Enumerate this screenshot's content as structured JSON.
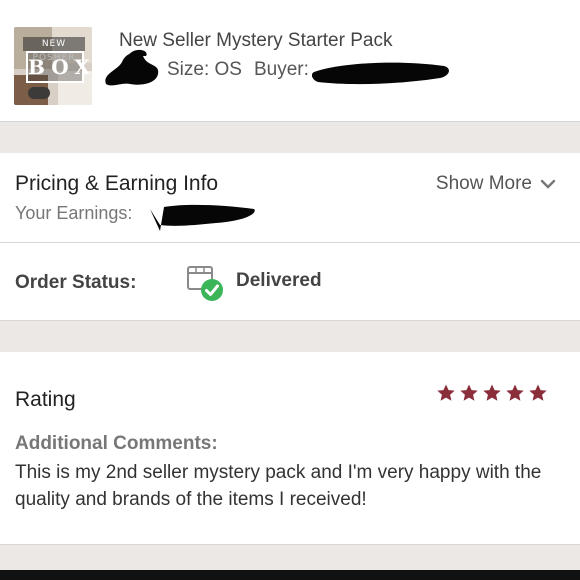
{
  "product": {
    "title": "New Seller Mystery Starter Pack",
    "size": "Size: OS",
    "buyer_label": "Buyer:",
    "thumbnail_caption": "NEW POSHER",
    "thumbnail_word": "BOX"
  },
  "pricing": {
    "title": "Pricing & Earning Info",
    "earnings_label": "Your Earnings:",
    "show_more": "Show More"
  },
  "order_status": {
    "label": "Order Status:",
    "value": "Delivered",
    "icon": "delivered-box-icon"
  },
  "rating": {
    "title": "Rating",
    "stars": 5,
    "star_color": "#8b2e3c",
    "comments_label": "Additional Comments:",
    "comments": "This is my 2nd seller mystery pack and I'm very happy with the quality and brands of the items I received!"
  },
  "colors": {
    "divider": "#ebe8e5",
    "status_check": "#3cb558",
    "text_primary": "#222222",
    "text_muted": "#777777"
  }
}
